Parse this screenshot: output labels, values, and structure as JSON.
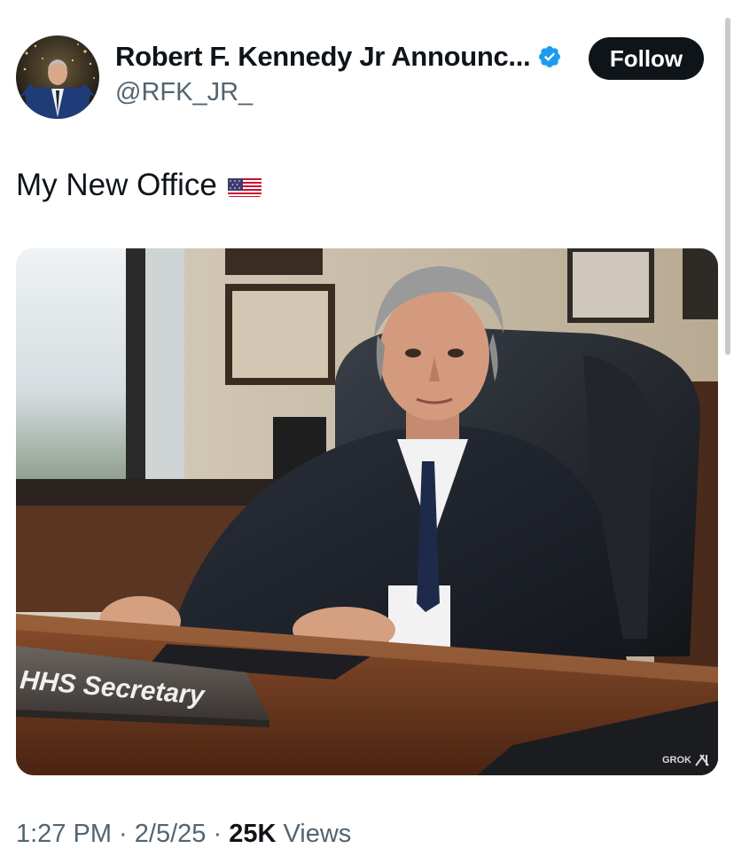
{
  "author": {
    "name": "Robert F. Kennedy Jr Announc...",
    "handle": "@RFK_JR_",
    "verified_color": "#1d9bf0"
  },
  "follow_label": "Follow",
  "tweet": {
    "text": "My New Office",
    "emoji": "us-flag-icon"
  },
  "media": {
    "nameplate_text": "HHS Secretary",
    "watermark": "GROK"
  },
  "meta": {
    "time": "1:27 PM",
    "sep1": " · ",
    "date": "2/5/25",
    "sep2": " · ",
    "views_count": "25K",
    "views_label": " Views"
  }
}
